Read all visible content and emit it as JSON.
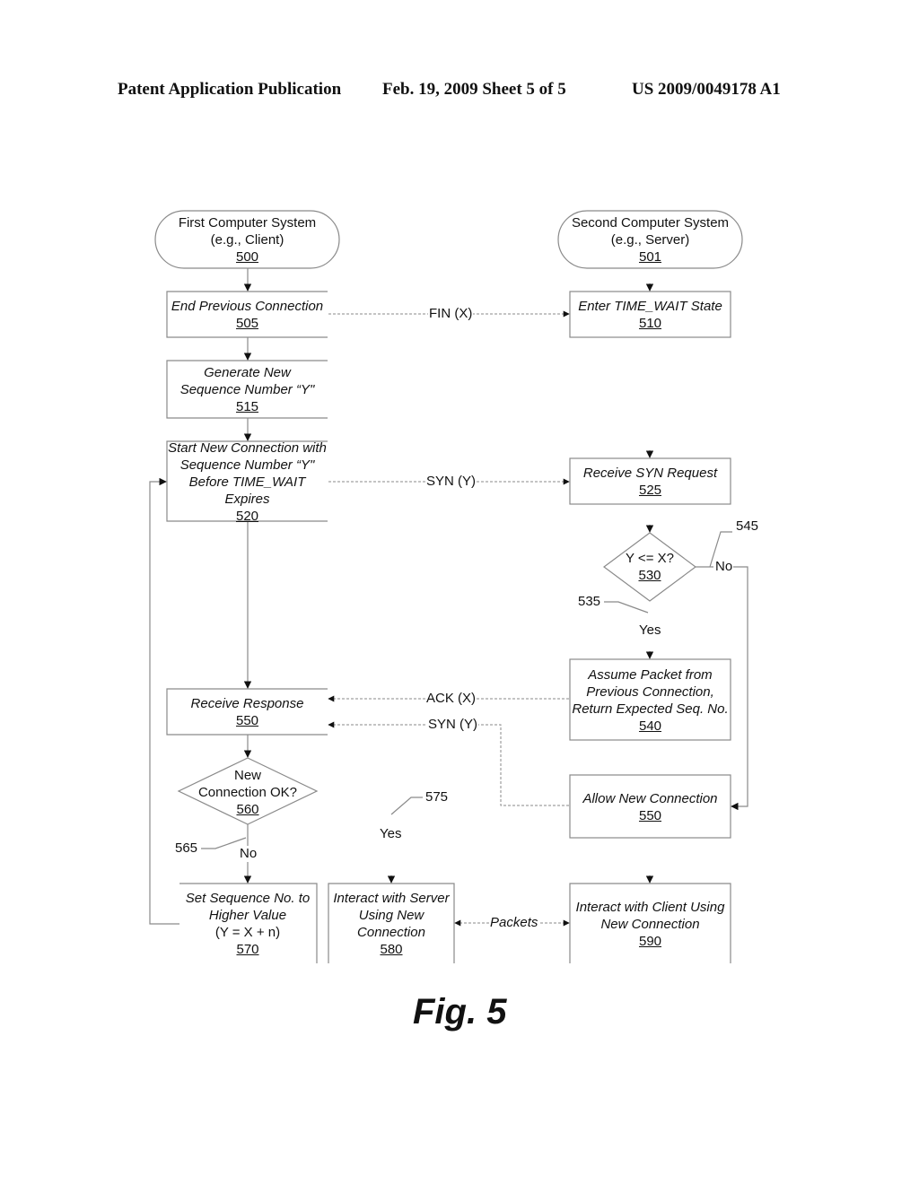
{
  "header": {
    "publication": "Patent Application Publication",
    "date_sheet": "Feb. 19, 2009   Sheet 5 of 5",
    "patent_number": "US 2009/0049178 A1"
  },
  "figure_label": "Fig. 5",
  "nodes": {
    "n500": {
      "lines": [
        "First Computer System",
        "(e.g., Client)"
      ],
      "number": "500",
      "shape": "terminal"
    },
    "n501": {
      "lines": [
        "Second Computer System",
        "(e.g., Server)"
      ],
      "number": "501",
      "shape": "terminal"
    },
    "n505": {
      "lines": [
        "End Previous Connection"
      ],
      "number": "505",
      "shape": "process"
    },
    "n510": {
      "lines": [
        "Enter TIME_WAIT State"
      ],
      "number": "510",
      "shape": "process"
    },
    "n515": {
      "lines": [
        "Generate New",
        "Sequence Number “Y\""
      ],
      "number": "515",
      "shape": "process"
    },
    "n520": {
      "lines": [
        "Start New Connection with",
        "Sequence Number “Y\"",
        "Before TIME_WAIT Expires"
      ],
      "number": "520",
      "shape": "process"
    },
    "n525": {
      "lines": [
        "Receive SYN Request"
      ],
      "number": "525",
      "shape": "process"
    },
    "n530": {
      "lines": [
        "Y <= X?"
      ],
      "number": "530",
      "shape": "decision"
    },
    "n540": {
      "lines": [
        "Assume Packet from",
        "Previous Connection,",
        "Return Expected Seq. No."
      ],
      "number": "540",
      "shape": "process"
    },
    "n550a": {
      "lines": [
        "Receive Response"
      ],
      "number": "550",
      "shape": "process"
    },
    "n550b": {
      "lines": [
        "Allow New Connection"
      ],
      "number": "550",
      "shape": "process"
    },
    "n560": {
      "lines": [
        "New",
        "Connection OK?"
      ],
      "number": "560",
      "shape": "decision"
    },
    "n570": {
      "lines": [
        "Set Sequence No. to",
        "Higher Value",
        "(Y = X + n)"
      ],
      "number": "570",
      "shape": "process"
    },
    "n580": {
      "lines": [
        "Interact with Server",
        "Using New",
        "Connection"
      ],
      "number": "580",
      "shape": "process"
    },
    "n590": {
      "lines": [
        "Interact with Client Using",
        "New Connection"
      ],
      "number": "590",
      "shape": "process"
    }
  },
  "edge_labels": {
    "fin": "FIN (X)",
    "syn_request": "SYN (Y)",
    "ack": "ACK (X)",
    "syn_response": "SYN (Y)",
    "packets": "Packets",
    "no_530": "No",
    "yes_530": "Yes",
    "no_560": "No",
    "yes_560": "Yes"
  },
  "reference_numerals": {
    "r535": "535",
    "r545": "545",
    "r565": "565",
    "r575": "575"
  },
  "colors": {
    "line": "#8a8a8a",
    "arrow": "#111111",
    "text": "#111111"
  }
}
